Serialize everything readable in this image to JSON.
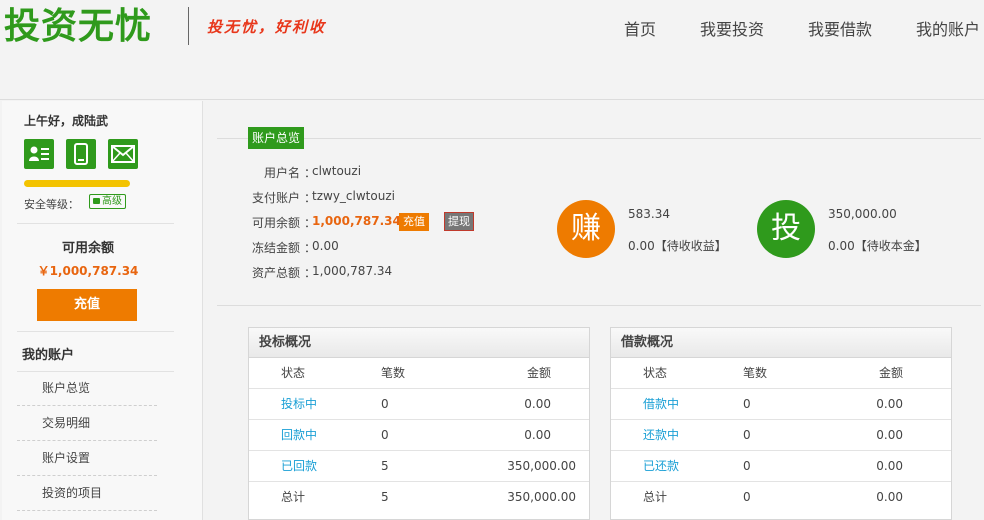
{
  "header": {
    "logo": "投资无忧",
    "slogan": "投无忧，好利收",
    "nav": [
      "首页",
      "我要投资",
      "我要借款",
      "我的账户"
    ]
  },
  "sidebar": {
    "greeting": "上午好，成陆武",
    "security_label": "安全等级：",
    "security_level": "高级",
    "available_label": "可用余额",
    "available_value": "￥1,000,787.34",
    "recharge": "充值",
    "my_account": "我的账户",
    "menu": [
      "账户总览",
      "交易明细",
      "账户设置",
      "投资的项目"
    ]
  },
  "overview": {
    "tag": "账户总览",
    "fields": [
      {
        "label": "用户名",
        "value": "clwtouzi"
      },
      {
        "label": "支付账户",
        "value": "tzwy_clwtouzi"
      },
      {
        "label": "可用余额",
        "value": "1,000,787.34"
      },
      {
        "label": "冻结金额",
        "value": "0.00"
      },
      {
        "label": "资产总额",
        "value": "1,000,787.34"
      }
    ],
    "colon": "：",
    "recharge_btn": "充值",
    "withdraw_btn": "提现",
    "earn": {
      "glyph": "赚",
      "line1": "583.34",
      "line2": "0.00【待收收益】"
    },
    "invest": {
      "glyph": "投",
      "line1": "350,000.00",
      "line2": "0.00【待收本金】"
    }
  },
  "bid_panel": {
    "title": "投标概况",
    "headers": [
      "状态",
      "笔数",
      "金额"
    ],
    "rows": [
      [
        "投标中",
        "0",
        "0.00"
      ],
      [
        "回款中",
        "0",
        "0.00"
      ],
      [
        "已回款",
        "5",
        "350,000.00"
      ],
      [
        "总计",
        "5",
        "350,000.00"
      ]
    ]
  },
  "loan_panel": {
    "title": "借款概况",
    "headers": [
      "状态",
      "笔数",
      "金额"
    ],
    "rows": [
      [
        "借款中",
        "0",
        "0.00"
      ],
      [
        "还款中",
        "0",
        "0.00"
      ],
      [
        "已还款",
        "0",
        "0.00"
      ],
      [
        "总计",
        "0",
        "0.00"
      ]
    ]
  },
  "colors": {
    "green": "#2f9a1c",
    "orange": "#ee7b00",
    "link": "#1a9fd5",
    "slogan": "#e8371b"
  },
  "icons": [
    "contact-card-icon",
    "mobile-phone-icon",
    "mail-icon",
    "lock-icon"
  ]
}
